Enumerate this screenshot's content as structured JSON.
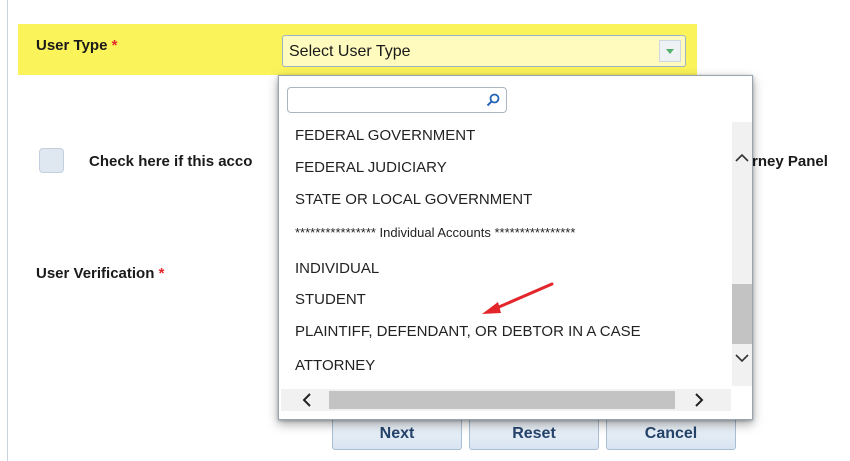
{
  "form": {
    "user_type_label": "User Type",
    "required_marker": "*",
    "select_value": "Select User Type",
    "checkbox_text_start": "Check here if this acco",
    "checkbox_text_end": "rney Panel",
    "user_verification_label": "User Verification"
  },
  "dropdown": {
    "search_value": "",
    "options": [
      "FEDERAL GOVERNMENT",
      "FEDERAL JUDICIARY",
      "STATE OR LOCAL GOVERNMENT",
      "**************** Individual Accounts ****************",
      "INDIVIDUAL",
      "STUDENT",
      "PLAINTIFF, DEFENDANT, OR DEBTOR IN A CASE",
      "ATTORNEY"
    ]
  },
  "buttons": {
    "next": "Next",
    "reset": "Reset",
    "cancel": "Cancel"
  },
  "colors": {
    "highlight": "#fbf35a",
    "required": "#e3262a",
    "annotation_arrow": "#e3262a",
    "button_text": "#25446c"
  },
  "icons": [
    "search-icon",
    "chevron-down-icon",
    "chevron-up-icon",
    "chevron-left-icon",
    "chevron-right-icon",
    "arrow-annotation"
  ]
}
